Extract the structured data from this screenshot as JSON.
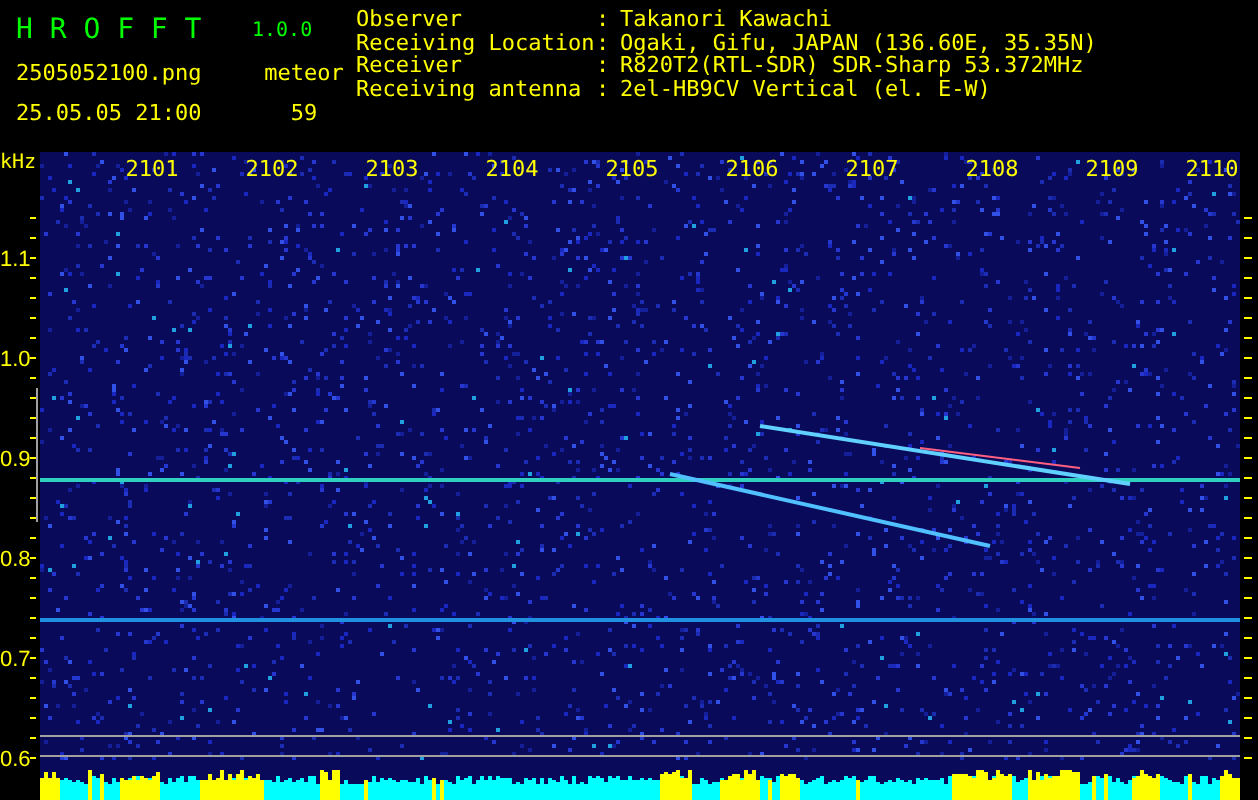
{
  "header": {
    "app_name": "H R O F F T",
    "version": "1.0.0",
    "file_name": "2505052100.png",
    "datetime": "25.05.05 21:00",
    "count_label": "meteor",
    "count": "59",
    "info": [
      {
        "label": "Observer",
        "separator": ":",
        "value": "Takanori Kawachi"
      },
      {
        "label": "Receiving Location",
        "separator": ":",
        "value": "Ogaki, Gifu, JAPAN (136.60E, 35.35N)"
      },
      {
        "label": "Receiver",
        "separator": ":",
        "value": "R820T2(RTL-SDR) SDR-Sharp 53.372MHz"
      },
      {
        "label": "Receiving antenna",
        "separator": ":",
        "value": "2el-HB9CV Vertical (el. E-W)"
      }
    ]
  },
  "axes": {
    "y_unit": "kHz",
    "y_labels": [
      "1.1",
      "1.0",
      "0.9",
      "0.8",
      "0.7",
      "0.6"
    ],
    "x_labels": [
      "2101",
      "2102",
      "2103",
      "2104",
      "2105",
      "2106",
      "2107",
      "2108",
      "2109",
      "2110"
    ]
  }
}
